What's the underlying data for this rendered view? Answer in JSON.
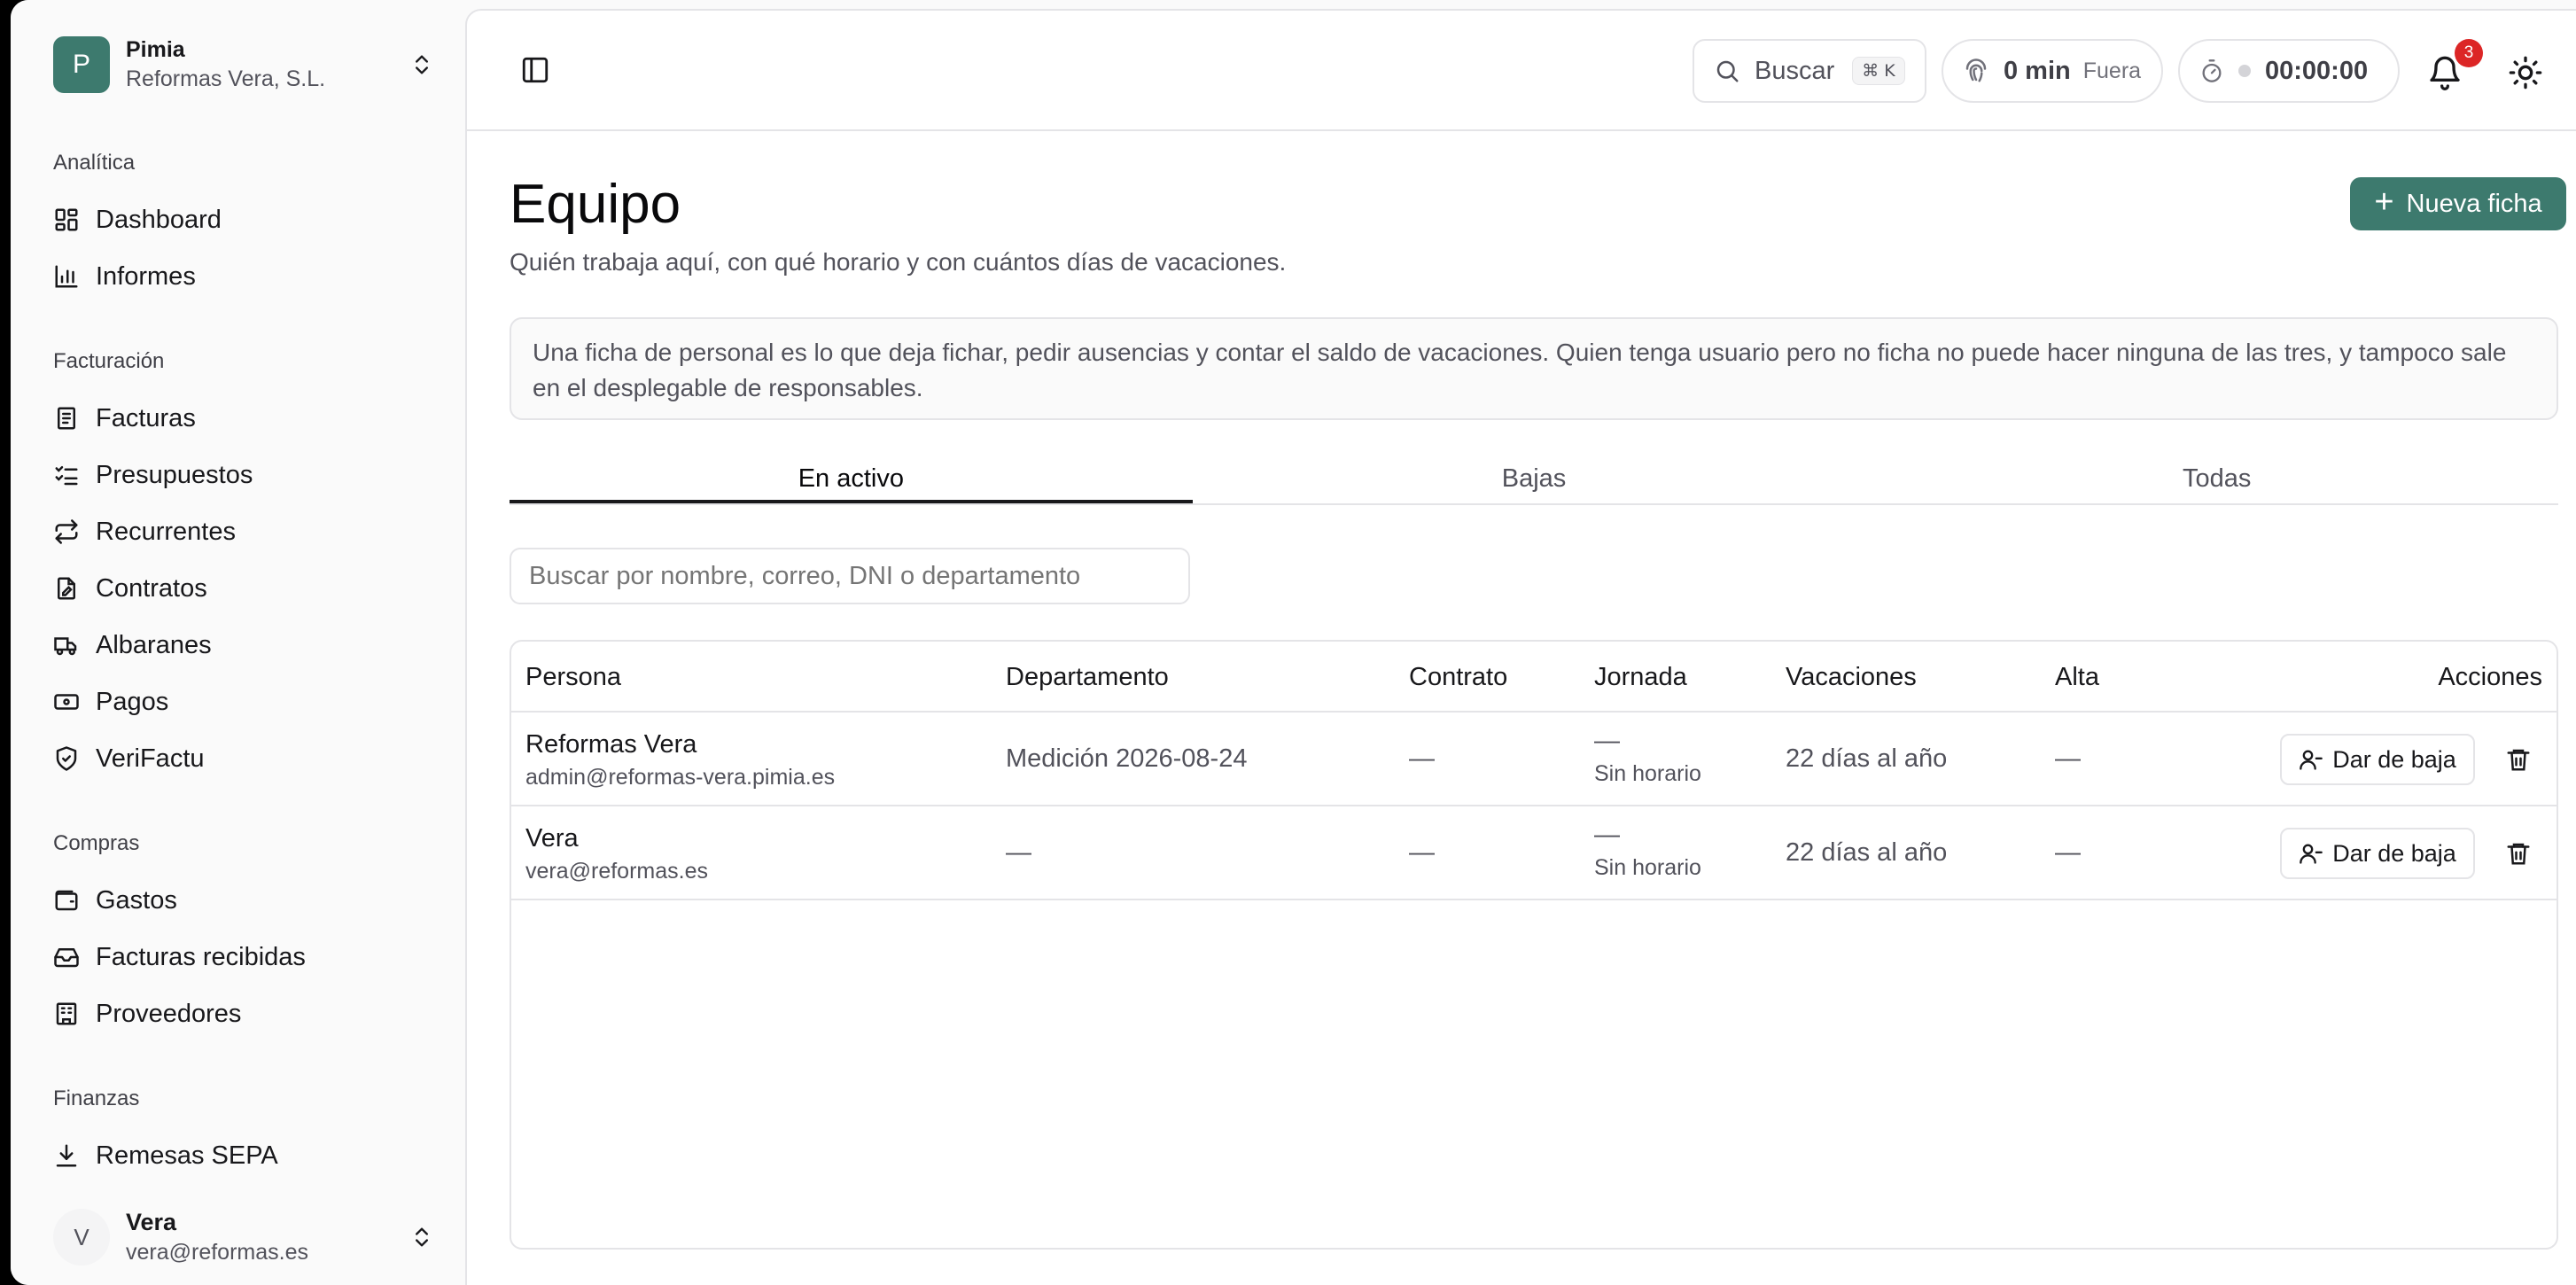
{
  "org": {
    "initial": "P",
    "name": "Pimia",
    "company": "Reformas Vera, S.L."
  },
  "sidebar": {
    "sections": [
      {
        "title": "Analítica",
        "items": [
          {
            "label": "Dashboard",
            "icon": "dashboard-icon"
          },
          {
            "label": "Informes",
            "icon": "bar-chart-icon"
          }
        ]
      },
      {
        "title": "Facturación",
        "items": [
          {
            "label": "Facturas",
            "icon": "receipt-icon"
          },
          {
            "label": "Presupuestos",
            "icon": "list-check-icon"
          },
          {
            "label": "Recurrentes",
            "icon": "repeat-icon"
          },
          {
            "label": "Contratos",
            "icon": "file-signature-icon"
          },
          {
            "label": "Albaranes",
            "icon": "truck-icon"
          },
          {
            "label": "Pagos",
            "icon": "banknote-icon"
          },
          {
            "label": "VeriFactu",
            "icon": "shield-check-icon"
          }
        ]
      },
      {
        "title": "Compras",
        "items": [
          {
            "label": "Gastos",
            "icon": "wallet-icon"
          },
          {
            "label": "Facturas recibidas",
            "icon": "inbox-icon"
          },
          {
            "label": "Proveedores",
            "icon": "building-icon"
          }
        ]
      },
      {
        "title": "Finanzas",
        "items": [
          {
            "label": "Remesas SEPA",
            "icon": "download-icon"
          }
        ]
      }
    ]
  },
  "user": {
    "initial": "V",
    "name": "Vera",
    "email": "vera@reformas.es"
  },
  "topbar": {
    "search_label": "Buscar",
    "search_kbd": "⌘ K",
    "clock_minutes": "0 min",
    "clock_status": "Fuera",
    "timer": "00:00:00",
    "notifications": "3"
  },
  "page": {
    "title": "Equipo",
    "subtitle": "Quién trabaja aquí, con qué horario y con cuántos días de vacaciones.",
    "new_button": "Nueva ficha",
    "info": "Una ficha de personal es lo que deja fichar, pedir ausencias y contar el saldo de vacaciones. Quien tenga usuario pero no ficha no puede hacer ninguna de las tres, y tampoco sale en el desplegable de responsables.",
    "tabs": [
      "En activo",
      "Bajas",
      "Todas"
    ],
    "filter_placeholder": "Buscar por nombre, correo, DNI o departamento"
  },
  "table": {
    "headers": {
      "persona": "Persona",
      "departamento": "Departamento",
      "contrato": "Contrato",
      "jornada": "Jornada",
      "vacaciones": "Vacaciones",
      "alta": "Alta",
      "acciones": "Acciones"
    },
    "rows": [
      {
        "name": "Reformas Vera",
        "email": "admin@reformas-vera.pimia.es",
        "departamento": "Medición 2026-08-24",
        "contrato": "—",
        "jornada": "—",
        "jornada_sub": "Sin horario",
        "vacaciones": "22 días al año",
        "alta": "—",
        "action": "Dar de baja"
      },
      {
        "name": "Vera",
        "email": "vera@reformas.es",
        "departamento": "—",
        "contrato": "—",
        "jornada": "—",
        "jornada_sub": "Sin horario",
        "vacaciones": "22 días al año",
        "alta": "—",
        "action": "Dar de baja"
      }
    ]
  },
  "colors": {
    "accent": "#3d7a6e",
    "badge": "#dc2626"
  }
}
